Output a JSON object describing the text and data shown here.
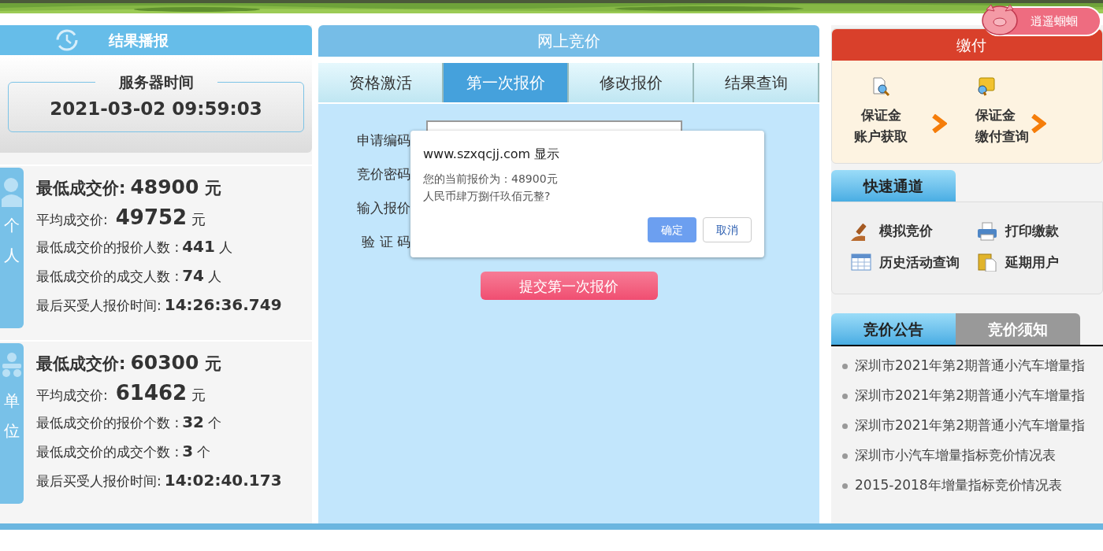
{
  "results": {
    "title": "结果播报",
    "server_time_label": "服务器时间",
    "server_time": "2021-03-02 09:59:03",
    "groups": [
      {
        "tab": "个人",
        "rows": [
          {
            "kind": "headline",
            "label": "最低成交价:",
            "value": "48900",
            "unit": "元"
          },
          {
            "kind": "average",
            "label": "平均成交价:",
            "value": "49752",
            "unit": "元"
          },
          {
            "kind": "stat",
            "label": "最低成交价的报价人数 :",
            "value": "441",
            "unit": "人"
          },
          {
            "kind": "stat",
            "label": "最低成交价的成交人数 :",
            "value": "74",
            "unit": "人"
          },
          {
            "kind": "stat",
            "label": "最后买受人报价时间:",
            "value": "14:26:36.749",
            "unit": ""
          }
        ]
      },
      {
        "tab": "单位",
        "rows": [
          {
            "kind": "headline",
            "label": "最低成交价:",
            "value": "60300",
            "unit": "元"
          },
          {
            "kind": "average",
            "label": "平均成交价:",
            "value": "61462",
            "unit": "元"
          },
          {
            "kind": "stat",
            "label": "最低成交价的报价个数 :",
            "value": "32",
            "unit": "个"
          },
          {
            "kind": "stat",
            "label": "最低成交价的成交个数 :",
            "value": "3",
            "unit": "个"
          },
          {
            "kind": "stat",
            "label": "最后买受人报价时间:",
            "value": "14:02:40.173",
            "unit": ""
          }
        ]
      }
    ]
  },
  "bidding": {
    "title": "网上竞价",
    "tabs": [
      {
        "label": "资格激活",
        "selected": false
      },
      {
        "label": "第一次报价",
        "selected": true
      },
      {
        "label": "修改报价",
        "selected": false
      },
      {
        "label": "结果查询",
        "selected": false
      }
    ],
    "fields": [
      {
        "label": "申请编码",
        "has_input": true
      },
      {
        "label": "竞价密码"
      },
      {
        "label": "输入报价"
      },
      {
        "label": "验 证 码"
      }
    ],
    "submit": "提交第一次报价",
    "dialog": {
      "origin": "www.szxqcjj.com 显示",
      "lines": [
        "您的当前报价为：48900元",
        "人民币肆万捌仟玖佰元整?"
      ],
      "buttons": [
        {
          "label": "确定",
          "kind": "primary"
        },
        {
          "label": "取消",
          "kind": "secondary"
        }
      ]
    }
  },
  "payment": {
    "title": "缴付",
    "steps": [
      {
        "line1": "保证金",
        "line2": "账户获取"
      },
      {
        "line1": "保证金",
        "line2": "缴付查询"
      }
    ]
  },
  "quick": {
    "title": "快速通道",
    "links": [
      "模拟竞价",
      "打印缴款",
      "历史活动查询",
      "延期用户"
    ]
  },
  "notices": {
    "tabs": [
      {
        "label": "竞价公告",
        "selected": true
      },
      {
        "label": "竞价须知",
        "selected": false
      }
    ],
    "items": [
      "深圳市2021年第2期普通小汽车增量指",
      "深圳市2021年第2期普通小汽车增量指",
      "深圳市2021年第2期普通小汽车增量指",
      "深圳市小汽车增量指标竞价情况表",
      "2015-2018年增量指标竞价情况表"
    ]
  },
  "pig_badge": {
    "label": "逍遥蝈蝈"
  }
}
